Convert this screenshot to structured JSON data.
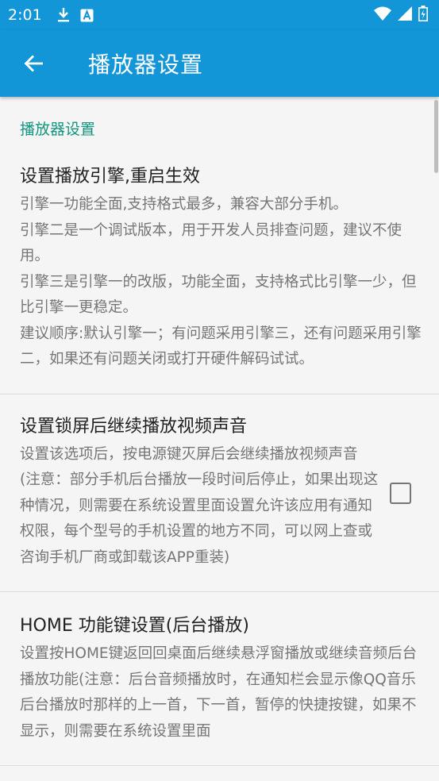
{
  "status_bar": {
    "time": "2:01",
    "icons": [
      "download-icon",
      "a-badge-icon",
      "wifi-icon",
      "signal-icon",
      "battery-icon"
    ]
  },
  "app_bar": {
    "title": "播放器设置",
    "back_icon": "arrow-left-icon",
    "color": "#1396d8"
  },
  "category": {
    "title": "播放器设置",
    "color": "#12967f"
  },
  "preferences": [
    {
      "title": "设置播放引擎,重启生效",
      "summary": "引擎一功能全面,支持格式最多，兼容大部分手机。\n引擎二是一个调试版本，用于开发人员排查问题，建议不使用。\n引擎三是引擎一的改版，功能全面，支持格式比引擎一少，但比引擎一更稳定。\n建议顺序:默认引擎一；有问题采用引擎三，还有问题采用引擎二，如果还有问题关闭或打开硬件解码试试。"
    },
    {
      "title": "设置锁屏后继续播放视频声音",
      "summary": "设置该选项后，按电源键灭屏后会继续播放视频声音\n(注意：部分手机后台播放一段时间后停止，如果出现这种情况，则需要在系统设置里面设置允许该应用有通知权限，每个型号的手机设置的地方不同，可以网上查或咨询手机厂商或卸载该APP重装)",
      "checked": false
    },
    {
      "title": "HOME 功能键设置(后台播放)",
      "summary": "设置按HOME键返回回桌面后继续悬浮窗播放或继续音频后台播放功能(注意：后台音频播放时，在通知栏会显示像QQ音乐后台播放时那样的上一首，下一首，暂停的快捷按键，如果不显示，则需要在系统设置里面"
    }
  ]
}
